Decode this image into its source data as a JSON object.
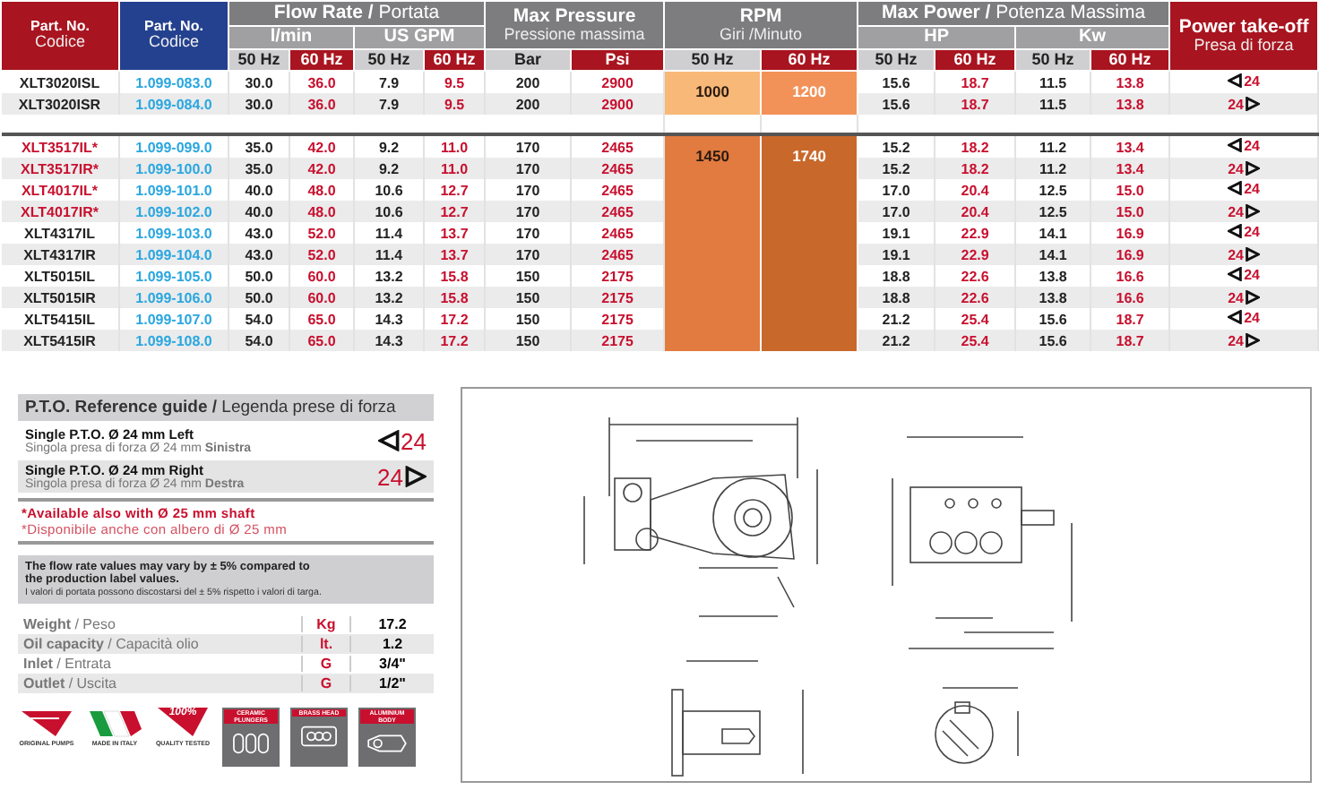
{
  "header": {
    "part_no": {
      "title": "Part. No.",
      "subtitle": "Codice"
    },
    "code": {
      "title": "Part. No.",
      "subtitle": "Codice"
    },
    "flow": "**Flow Rate /** Portata",
    "flow_units": [
      "l/min",
      "US GPM"
    ],
    "pressure": {
      "title": "Max Pressure",
      "subtitle": "Pressione massima"
    },
    "rpm": {
      "title": "RPM",
      "subtitle": "Giri /Minuto"
    },
    "power": "**Max Power /** Potenza Massima",
    "power_units": [
      "HP",
      "Kw"
    ],
    "pto": {
      "title": "Power take-off",
      "subtitle": "Presa di forza"
    },
    "subheads": [
      "50 Hz",
      "60 Hz",
      "50 Hz",
      "60 Hz",
      "Bar",
      "Psi",
      "50 Hz",
      "60 Hz",
      "50 Hz",
      "60 Hz",
      "50 Hz",
      "60 Hz"
    ]
  },
  "groups": [
    {
      "rpm": [
        {
          "value": "1000",
          "color": "#f8b878"
        },
        {
          "value": "1200",
          "color": "#f29258"
        }
      ],
      "rows": [
        {
          "model": "XLT3020ISL",
          "highlighted": false,
          "code": "1.099-083.0",
          "values": [
            "30.0",
            "36.0",
            "7.9",
            "9.5",
            "200",
            "2900",
            "15.6",
            "18.7",
            "11.5",
            "13.8"
          ],
          "pto": {
            "kind": "left",
            "size": "24"
          }
        },
        {
          "model": "XLT3020ISR",
          "highlighted": false,
          "code": "1.099-084.0",
          "values": [
            "30.0",
            "36.0",
            "7.9",
            "9.5",
            "200",
            "2900",
            "15.6",
            "18.7",
            "11.5",
            "13.8"
          ],
          "pto": {
            "kind": "right",
            "size": "24"
          }
        }
      ]
    },
    {
      "rpm": [
        {
          "value": "1450",
          "color": "#e27b3f"
        },
        {
          "value": "1740",
          "color": "#c9682b"
        }
      ],
      "rows": [
        {
          "model": "XLT3517IL*",
          "highlighted": true,
          "code": "1.099-099.0",
          "values": [
            "35.0",
            "42.0",
            "9.2",
            "11.0",
            "170",
            "2465",
            "15.2",
            "18.2",
            "11.2",
            "13.4"
          ],
          "pto": {
            "kind": "left",
            "size": "24"
          }
        },
        {
          "model": "XLT3517IR*",
          "highlighted": true,
          "code": "1.099-100.0",
          "values": [
            "35.0",
            "42.0",
            "9.2",
            "11.0",
            "170",
            "2465",
            "15.2",
            "18.2",
            "11.2",
            "13.4"
          ],
          "pto": {
            "kind": "right",
            "size": "24"
          }
        },
        {
          "model": "XLT4017IL*",
          "highlighted": true,
          "code": "1.099-101.0",
          "values": [
            "40.0",
            "48.0",
            "10.6",
            "12.7",
            "170",
            "2465",
            "17.0",
            "20.4",
            "12.5",
            "15.0"
          ],
          "pto": {
            "kind": "left",
            "size": "24"
          }
        },
        {
          "model": "XLT4017IR*",
          "highlighted": true,
          "code": "1.099-102.0",
          "values": [
            "40.0",
            "48.0",
            "10.6",
            "12.7",
            "170",
            "2465",
            "17.0",
            "20.4",
            "12.5",
            "15.0"
          ],
          "pto": {
            "kind": "right",
            "size": "24"
          }
        },
        {
          "model": "XLT4317IL",
          "highlighted": false,
          "code": "1.099-103.0",
          "values": [
            "43.0",
            "52.0",
            "11.4",
            "13.7",
            "170",
            "2465",
            "19.1",
            "22.9",
            "14.1",
            "16.9"
          ],
          "pto": {
            "kind": "left",
            "size": "24"
          }
        },
        {
          "model": "XLT4317IR",
          "highlighted": false,
          "code": "1.099-104.0",
          "values": [
            "43.0",
            "52.0",
            "11.4",
            "13.7",
            "170",
            "2465",
            "19.1",
            "22.9",
            "14.1",
            "16.9"
          ],
          "pto": {
            "kind": "right",
            "size": "24"
          }
        },
        {
          "model": "XLT5015IL",
          "highlighted": false,
          "code": "1.099-105.0",
          "values": [
            "50.0",
            "60.0",
            "13.2",
            "15.8",
            "150",
            "2175",
            "18.8",
            "22.6",
            "13.8",
            "16.6"
          ],
          "pto": {
            "kind": "left",
            "size": "24"
          }
        },
        {
          "model": "XLT5015IR",
          "highlighted": false,
          "code": "1.099-106.0",
          "values": [
            "50.0",
            "60.0",
            "13.2",
            "15.8",
            "150",
            "2175",
            "18.8",
            "22.6",
            "13.8",
            "16.6"
          ],
          "pto": {
            "kind": "right",
            "size": "24"
          }
        },
        {
          "model": "XLT5415IL",
          "highlighted": false,
          "code": "1.099-107.0",
          "values": [
            "54.0",
            "65.0",
            "14.3",
            "17.2",
            "150",
            "2175",
            "21.2",
            "25.4",
            "15.6",
            "18.7"
          ],
          "pto": {
            "kind": "left",
            "size": "24"
          }
        },
        {
          "model": "XLT5415IR",
          "highlighted": false,
          "code": "1.099-108.0",
          "values": [
            "54.0",
            "65.0",
            "14.3",
            "17.2",
            "150",
            "2175",
            "21.2",
            "25.4",
            "15.6",
            "18.7"
          ],
          "pto": {
            "kind": "right",
            "size": "24"
          }
        }
      ]
    }
  ],
  "pto_guide": {
    "title": "**P.T.O. Reference guide /** Legenda prese di forza",
    "items": [
      {
        "title": "Single P.T.O. Ø 24 mm Left",
        "subtitle": "Singola presa di forza Ø 24 mm **Sinistra**",
        "kind": "left",
        "size": "24"
      },
      {
        "title": "Single P.T.O. Ø 24 mm Right",
        "subtitle": "Singola presa di forza Ø 24 mm **Destra**",
        "kind": "right",
        "size": "24"
      }
    ],
    "notes": [
      "*Available also with Ø 25 mm shaft",
      "*Disponibile anche con albero di Ø 25 mm"
    ]
  },
  "disclaimer": {
    "main": "The flow rate values may vary by ± 5% compared to the production label values.",
    "translation": "I valori di portata possono discostarsi del ± 5% rispetto i valori di targa."
  },
  "specs": [
    {
      "label": "**Weight** / Peso",
      "unit": "Kg",
      "value": "17.2"
    },
    {
      "label": "**Oil capacity** / Capacità olio",
      "unit": "lt.",
      "value": "1.2"
    },
    {
      "label": "**Inlet** / Entrata",
      "unit": "G",
      "value": "3/4\""
    },
    {
      "label": "**Outlet** / Uscita",
      "unit": "G",
      "value": "1/2\""
    }
  ],
  "badges": [
    {
      "kind": "pump",
      "caption": "ORIGINAL PUMPS"
    },
    {
      "kind": "flag",
      "caption": "MADE IN ITALY"
    },
    {
      "kind": "quality",
      "caption": "QUALITY TESTED",
      "mark": "100%"
    },
    {
      "kind": "ceramic",
      "caption": "CERAMIC PLUNGERS"
    },
    {
      "kind": "brass",
      "caption": "BRASS HEAD"
    },
    {
      "kind": "aluminium",
      "caption": "ALUMINIUM BODY"
    }
  ]
}
